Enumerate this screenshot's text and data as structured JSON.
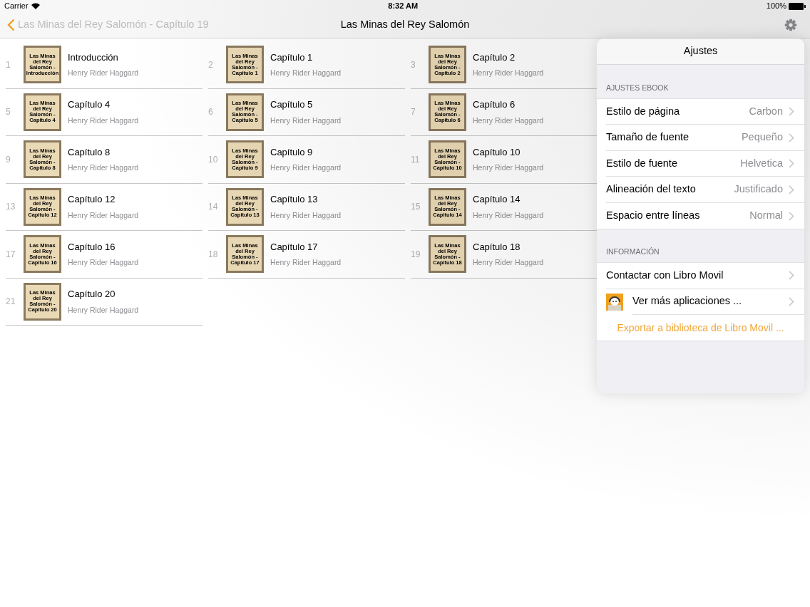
{
  "status_bar": {
    "carrier": "Carrier",
    "time": "8:32 AM",
    "battery": "100%"
  },
  "nav": {
    "back": "Las Minas del Rey Salomón - Capítulo 19",
    "title": "Las Minas del Rey Salomón"
  },
  "chapters": [
    {
      "number": "1",
      "cover": "Las Minas del Rey Salomón - Introducción",
      "title": "Introducción",
      "author": "Henry Rider Haggard"
    },
    {
      "number": "2",
      "cover": "Las Minas del Rey Salomón - Capitulo 1",
      "title": "Capítulo 1",
      "author": "Henry Rider Haggard"
    },
    {
      "number": "3",
      "cover": "Las Minas del Rey Salomón - Capitulo 2",
      "title": "Capítulo 2",
      "author": "Henry Rider Haggard"
    },
    {
      "number": "5",
      "cover": "Las Minas del Rey Salomón - Capitulo 4",
      "title": "Capítulo 4",
      "author": "Henry Rider Haggard"
    },
    {
      "number": "6",
      "cover": "Las Minas del Rey Salomón - Capitulo 5",
      "title": "Capítulo 5",
      "author": "Henry Rider Haggard"
    },
    {
      "number": "7",
      "cover": "Las Minas del Rey Salomón - Capitulo 6",
      "title": "Capítulo 6",
      "author": "Henry Rider Haggard"
    },
    {
      "number": "9",
      "cover": "Las Minas del Rey Salomón - Capitulo 8",
      "title": "Capítulo 8",
      "author": "Henry Rider Haggard"
    },
    {
      "number": "10",
      "cover": "Las Minas del Rey Salomón - Capitulo 9",
      "title": "Capítulo 9",
      "author": "Henry Rider Haggard"
    },
    {
      "number": "11",
      "cover": "Las Minas del Rey Salomón - Capitulo 10",
      "title": "Capítulo 10",
      "author": "Henry Rider Haggard"
    },
    {
      "number": "13",
      "cover": "Las Minas del Rey Salomón - Capitulo 12",
      "title": "Capítulo 12",
      "author": "Henry Rider Haggard"
    },
    {
      "number": "14",
      "cover": "Las Minas del Rey Salomón - Capitulo 13",
      "title": "Capítulo 13",
      "author": "Henry Rider Haggard"
    },
    {
      "number": "15",
      "cover": "Las Minas del Rey Salomón - Capitulo 14",
      "title": "Capítulo 14",
      "author": "Henry Rider Haggard"
    },
    {
      "number": "17",
      "cover": "Las Minas del Rey Salomón - Capitulo 16",
      "title": "Capítulo 16",
      "author": "Henry Rider Haggard"
    },
    {
      "number": "18",
      "cover": "Las Minas del Rey Salomón - Capitulo 17",
      "title": "Capítulo 17",
      "author": "Henry Rider Haggard"
    },
    {
      "number": "19",
      "cover": "Las Minas del Rey Salomón - Capitulo 18",
      "title": "Capítulo 18",
      "author": "Henry Rider Haggard"
    },
    {
      "number": "21",
      "cover": "Las Minas del Rey Salomón - Capitulo 20",
      "title": "Capítulo 20",
      "author": "Henry Rider Haggard"
    }
  ],
  "settings": {
    "title": "Ajustes",
    "sections": [
      {
        "header": "AJUSTES EBOOK",
        "rows": [
          {
            "kind": "value",
            "label": "Estilo de página",
            "value": "Carbon"
          },
          {
            "kind": "value",
            "label": "Tamaño de fuente",
            "value": "Pequeño"
          },
          {
            "kind": "value",
            "label": "Estilo de fuente",
            "value": "Helvetica"
          },
          {
            "kind": "value",
            "label": "Alineación del texto",
            "value": "Justificado"
          },
          {
            "kind": "value",
            "label": "Espacio entre líneas",
            "value": "Normal"
          }
        ]
      },
      {
        "header": "INFORMACIÓN",
        "rows": [
          {
            "kind": "link",
            "label": "Contactar con Libro Movil"
          },
          {
            "kind": "app",
            "label": "Ver más aplicaciones ..."
          },
          {
            "kind": "action",
            "label": "Exportar a biblioteca de Libro Movil ..."
          }
        ]
      }
    ]
  }
}
